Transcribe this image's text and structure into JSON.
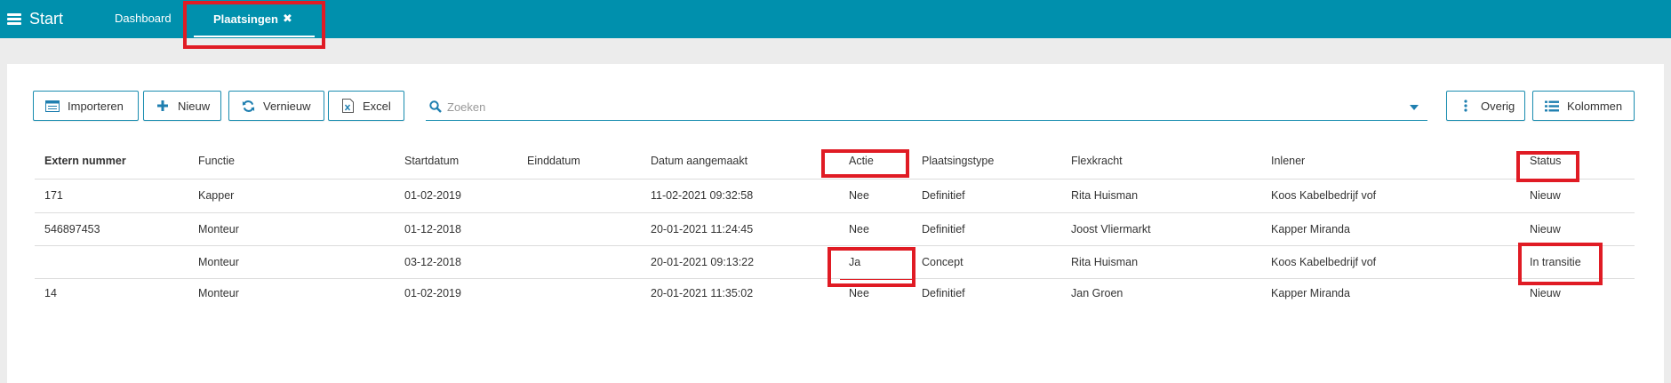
{
  "topbar": {
    "menu_label": "Start",
    "tabs": [
      {
        "label": "Dashboard"
      },
      {
        "label": "Plaatsingen",
        "close_glyph": "✖"
      }
    ]
  },
  "toolbar": {
    "import_label": "Importeren",
    "new_label": "Nieuw",
    "refresh_label": "Vernieuw",
    "excel_label": "Excel",
    "other_label": "Overig",
    "columns_label": "Kolommen"
  },
  "search": {
    "placeholder": "Zoeken"
  },
  "table": {
    "columns": [
      "Extern nummer",
      "Functie",
      "Startdatum",
      "Einddatum",
      "Datum aangemaakt",
      "Actie",
      "Plaatsingstype",
      "Flexkracht",
      "Inlener",
      "Status"
    ],
    "rows": [
      {
        "extern": "171",
        "functie": "Kapper",
        "start": "01-02-2019",
        "eind": "",
        "aangemaakt": "11-02-2021 09:32:58",
        "actie": "Nee",
        "type": "Definitief",
        "flex": "Rita Huisman",
        "inlener": "Koos Kabelbedrijf vof",
        "status": "Nieuw"
      },
      {
        "extern": "546897453",
        "functie": "Monteur",
        "start": "01-12-2018",
        "eind": "",
        "aangemaakt": "20-01-2021 11:24:45",
        "actie": "Nee",
        "type": "Definitief",
        "flex": "Joost Vliermarkt",
        "inlener": "Kapper Miranda",
        "status": "Nieuw"
      },
      {
        "extern": "",
        "functie": "Monteur",
        "start": "03-12-2018",
        "eind": "",
        "aangemaakt": "20-01-2021 09:13:22",
        "actie": "Ja",
        "type": "Concept",
        "flex": "Rita Huisman",
        "inlener": "Koos Kabelbedrijf vof",
        "status": "In transitie"
      },
      {
        "extern": "14",
        "functie": "Monteur",
        "start": "01-02-2019",
        "eind": "",
        "aangemaakt": "20-01-2021 11:35:02",
        "actie": "Nee",
        "type": "Definitief",
        "flex": "Jan Groen",
        "inlener": "Kapper Miranda",
        "status": "Nieuw"
      }
    ]
  },
  "icons": {
    "menu": "hamburger-icon",
    "import": "import-icon",
    "new": "plus-icon",
    "refresh": "refresh-icon",
    "excel": "excel-icon",
    "search": "search-icon",
    "other": "vertical-dots-icon",
    "columns": "list-icon"
  },
  "colors": {
    "topbar": "#0090ad",
    "accent": "#1a8db0",
    "highlight": "#e01b24"
  }
}
